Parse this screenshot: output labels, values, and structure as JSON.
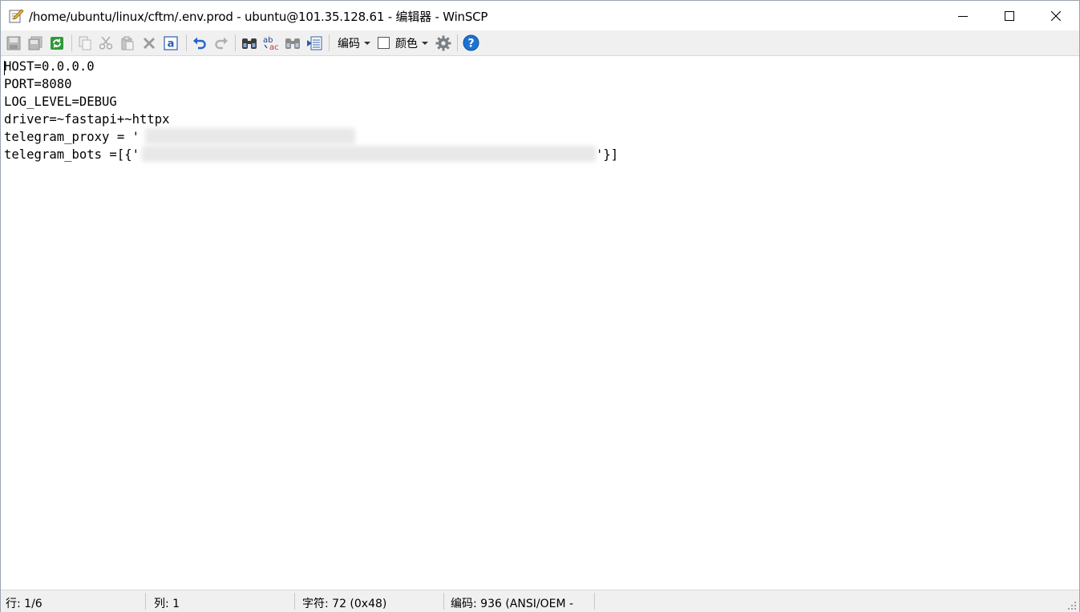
{
  "window": {
    "title": "/home/ubuntu/linux/cftm/.env.prod - ubuntu@101.35.128.61 - 编辑器 - WinSCP"
  },
  "toolbar": {
    "encoding_label": "编码",
    "color_label": "颜色",
    "icons": [
      "save-icon",
      "save-all-icon",
      "reload-icon",
      "copy-icon",
      "cut-icon",
      "paste-icon",
      "delete-icon",
      "select-all-icon",
      "undo-icon",
      "redo-icon",
      "find-icon",
      "replace-icon",
      "find-next-icon",
      "goto-line-icon",
      "settings-icon",
      "help-icon"
    ]
  },
  "editor": {
    "lines": [
      "HOST=0.0.0.0",
      "PORT=8080",
      "LOG_LEVEL=DEBUG",
      "driver=~fastapi+~httpx",
      "telegram_proxy = '",
      "telegram_bots =[{'"
    ],
    "line6_tail": "'}]"
  },
  "status": {
    "line": "行: 1/6",
    "column": "列: 1",
    "chars": "字符: 72 (0x48)",
    "encoding": "编码: 936  (ANSI/OEM -"
  },
  "colors": {
    "toolbar_bg": "#f0f0f0",
    "help_blue": "#1e73d2",
    "undo_blue": "#2563c9"
  }
}
